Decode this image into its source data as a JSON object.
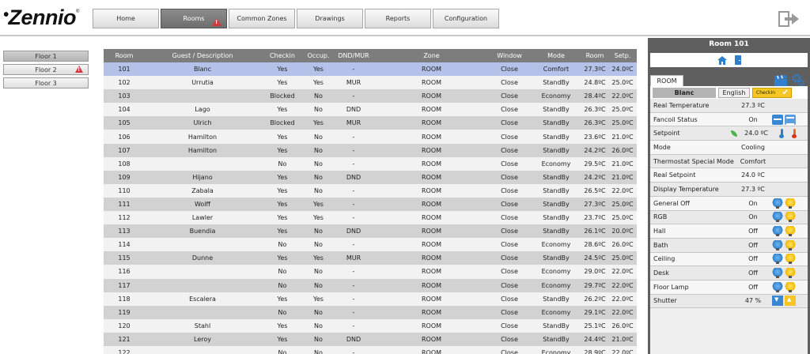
{
  "logo": {
    "text": "Zennio"
  },
  "nav": {
    "items": [
      {
        "label": "Home"
      },
      {
        "label": "Rooms"
      },
      {
        "label": "Common Zones"
      },
      {
        "label": "Drawings"
      },
      {
        "label": "Reports"
      },
      {
        "label": "Configuration"
      }
    ],
    "active": "Rooms"
  },
  "floors": [
    {
      "label": "Floor 1"
    },
    {
      "label": "Floor 2"
    },
    {
      "label": "Floor 3"
    }
  ],
  "table": {
    "headers": [
      "Room",
      "Guest / Description",
      "Checkin",
      "Occup.",
      "DND/MUR",
      "Zone",
      "Window",
      "Mode",
      "Room",
      "Setp."
    ],
    "rows": [
      [
        "101",
        "Blanc",
        "Yes",
        "Yes",
        "-",
        "ROOM",
        "Close",
        "Comfort",
        "27.3ºC",
        "24.0ºC"
      ],
      [
        "102",
        "Urrutia",
        "Yes",
        "Yes",
        "MUR",
        "ROOM",
        "Close",
        "StandBy",
        "24.8ºC",
        "25.0ºC"
      ],
      [
        "103",
        "",
        "Blocked",
        "No",
        "-",
        "ROOM",
        "Close",
        "Economy",
        "28.4ºC",
        "22.0ºC"
      ],
      [
        "104",
        "Lago",
        "Yes",
        "No",
        "DND",
        "ROOM",
        "Close",
        "StandBy",
        "26.3ºC",
        "25.0ºC"
      ],
      [
        "105",
        "Ulrich",
        "Blocked",
        "Yes",
        "MUR",
        "ROOM",
        "Close",
        "StandBy",
        "26.3ºC",
        "25.0ºC"
      ],
      [
        "106",
        "Hamilton",
        "Yes",
        "No",
        "-",
        "ROOM",
        "Close",
        "StandBy",
        "23.6ºC",
        "21.0ºC"
      ],
      [
        "107",
        "Hamilton",
        "Yes",
        "No",
        "-",
        "ROOM",
        "Close",
        "StandBy",
        "24.2ºC",
        "26.0ºC"
      ],
      [
        "108",
        "",
        "No",
        "No",
        "-",
        "ROOM",
        "Close",
        "Economy",
        "29.5ºC",
        "21.0ºC"
      ],
      [
        "109",
        "Hijano",
        "Yes",
        "No",
        "DND",
        "ROOM",
        "Close",
        "StandBy",
        "24.2ºC",
        "21.0ºC"
      ],
      [
        "110",
        "Zabala",
        "Yes",
        "No",
        "-",
        "ROOM",
        "Close",
        "StandBy",
        "26.5ºC",
        "22.0ºC"
      ],
      [
        "111",
        "Wolff",
        "Yes",
        "Yes",
        "-",
        "ROOM",
        "Close",
        "StandBy",
        "27.3ºC",
        "25.0ºC"
      ],
      [
        "112",
        "Lawler",
        "Yes",
        "Yes",
        "-",
        "ROOM",
        "Close",
        "StandBy",
        "23.7ºC",
        "25.0ºC"
      ],
      [
        "113",
        "Buendia",
        "Yes",
        "No",
        "DND",
        "ROOM",
        "Close",
        "StandBy",
        "26.1ºC",
        "20.0ºC"
      ],
      [
        "114",
        "",
        "No",
        "No",
        "-",
        "ROOM",
        "Close",
        "Economy",
        "28.6ºC",
        "26.0ºC"
      ],
      [
        "115",
        "Dunne",
        "Yes",
        "Yes",
        "MUR",
        "ROOM",
        "Close",
        "StandBy",
        "24.5ºC",
        "25.0ºC"
      ],
      [
        "116",
        "",
        "No",
        "No",
        "-",
        "ROOM",
        "Close",
        "Economy",
        "29.0ºC",
        "22.0ºC"
      ],
      [
        "117",
        "",
        "No",
        "No",
        "-",
        "ROOM",
        "Close",
        "Economy",
        "29.7ºC",
        "22.0ºC"
      ],
      [
        "118",
        "Escalera",
        "Yes",
        "Yes",
        "-",
        "ROOM",
        "Close",
        "StandBy",
        "26.2ºC",
        "22.0ºC"
      ],
      [
        "119",
        "",
        "No",
        "No",
        "-",
        "ROOM",
        "Close",
        "Economy",
        "29.1ºC",
        "22.0ºC"
      ],
      [
        "120",
        "Stahl",
        "Yes",
        "No",
        "-",
        "ROOM",
        "Close",
        "StandBy",
        "25.1ºC",
        "26.0ºC"
      ],
      [
        "121",
        "Leroy",
        "Yes",
        "No",
        "DND",
        "ROOM",
        "Close",
        "StandBy",
        "24.4ºC",
        "21.0ºC"
      ],
      [
        "122",
        "",
        "No",
        "No",
        "-",
        "ROOM",
        "Close",
        "Economy",
        "28.9ºC",
        "22.0ºC"
      ]
    ]
  },
  "panel": {
    "title": "Room 101",
    "tab": "ROOM",
    "guest_name": "Blanc",
    "language": "English",
    "checkin_label": "CheckIn",
    "props": [
      {
        "label": "Real Temperature",
        "value": "27.3 ºC",
        "icons": []
      },
      {
        "label": "Fancoil Status",
        "value": "On",
        "icons": [
          "fancoil-low-icon",
          "fancoil-high-icon"
        ]
      },
      {
        "label": "Setpoint",
        "value": "24.0 ºC",
        "icons": [
          "thermometer-down-icon",
          "thermometer-up-icon"
        ]
      },
      {
        "label": "Mode",
        "value": "Cooling",
        "icons": []
      },
      {
        "label": "Thermostat Special Mode",
        "value": "Comfort",
        "icons": []
      },
      {
        "label": "Real Setpoint",
        "value": "24.0 ºC",
        "icons": []
      },
      {
        "label": "Display Temperature",
        "value": "27.3 ºC",
        "icons": []
      },
      {
        "label": "General Off",
        "value": "On",
        "icons": [
          "light-off-icon",
          "light-on-icon"
        ]
      },
      {
        "label": "RGB",
        "value": "On",
        "icons": [
          "light-off-icon",
          "light-on-icon"
        ]
      },
      {
        "label": "Hall",
        "value": "Off",
        "icons": [
          "light-off-icon",
          "light-on-icon"
        ]
      },
      {
        "label": "Bath",
        "value": "Off",
        "icons": [
          "light-off-icon",
          "light-on-icon"
        ]
      },
      {
        "label": "Ceiling",
        "value": "Off",
        "icons": [
          "light-off-icon",
          "light-on-icon"
        ]
      },
      {
        "label": "Desk",
        "value": "Off",
        "icons": [
          "light-off-icon",
          "light-on-icon"
        ]
      },
      {
        "label": "Floor Lamp",
        "value": "Off",
        "icons": [
          "light-off-icon",
          "light-on-icon"
        ]
      },
      {
        "label": "Shutter",
        "value": "47 %",
        "icons": [
          "shutter-down-icon",
          "shutter-up-icon"
        ]
      }
    ]
  },
  "colors": {
    "active_nav": "#7a7a7a",
    "selected_row": "#b4c2ea",
    "header_bg": "#7d7d7d",
    "panel_bg": "#5f5f5f",
    "checkin": "#f6c628",
    "warning": "#d23a3a"
  }
}
